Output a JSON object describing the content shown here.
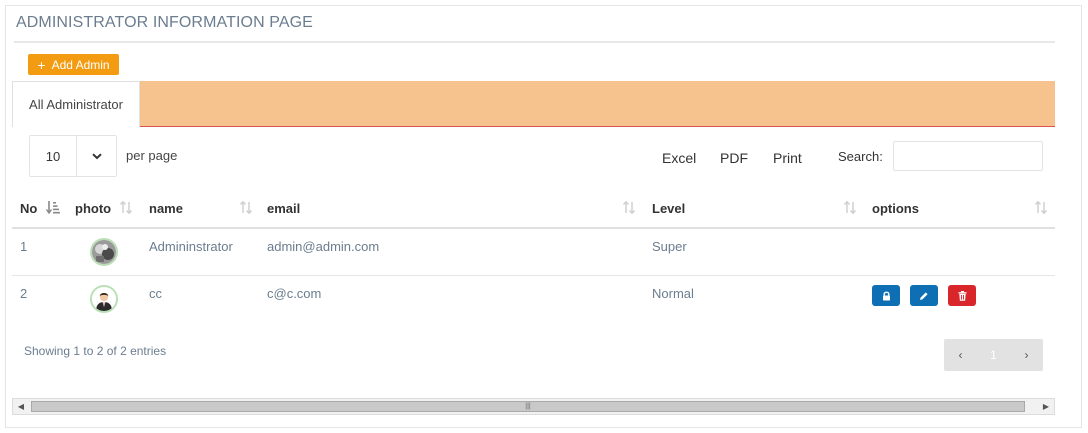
{
  "page": {
    "title": "ADMINISTRATOR INFORMATION PAGE"
  },
  "toolbar": {
    "add_label": "Add Admin",
    "add_icon": "plus-icon"
  },
  "tabs": [
    {
      "label": "All Administrator",
      "active": true
    }
  ],
  "table_controls": {
    "page_length": "10",
    "per_page_label": "per page",
    "export_buttons": [
      "Excel",
      "PDF",
      "Print"
    ],
    "search_label": "Search:",
    "search_value": ""
  },
  "table": {
    "columns": [
      "No",
      "photo",
      "name",
      "email",
      "Level",
      "options"
    ],
    "rows": [
      {
        "no": "1",
        "photo": "avatar-photo",
        "name": "Admininstrator",
        "email": "admin@admin.com",
        "level": "Super",
        "options": []
      },
      {
        "no": "2",
        "photo": "avatar-suit",
        "name": "cc",
        "email": "c@c.com",
        "level": "Normal",
        "options": [
          "lock-icon",
          "edit-icon",
          "trash-icon"
        ]
      }
    ]
  },
  "footer": {
    "info": "Showing 1 to 2 of 2 entries",
    "pagination": {
      "prev": "‹",
      "current": "1",
      "next": "›"
    }
  },
  "colors": {
    "accent_orange": "#f39c12",
    "tab_bar": "#f6c38e",
    "tab_underline": "#d9534f",
    "button_blue": "#0f6fb5",
    "button_red": "#d9262a",
    "muted_text": "#6b7d8f"
  }
}
